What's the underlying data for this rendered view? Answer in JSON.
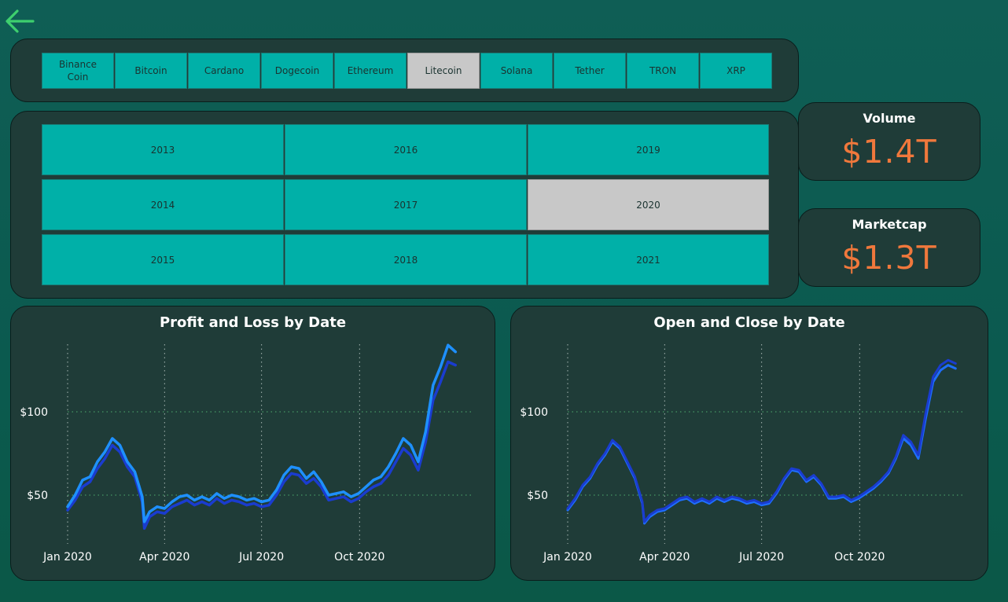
{
  "nav": {
    "back_icon": "arrow-left-icon",
    "back_color": "#3ecf6e"
  },
  "coins": [
    {
      "label": "Binance\nCoin",
      "selected": false
    },
    {
      "label": "Bitcoin",
      "selected": false
    },
    {
      "label": "Cardano",
      "selected": false
    },
    {
      "label": "Dogecoin",
      "selected": false
    },
    {
      "label": "Ethereum",
      "selected": false
    },
    {
      "label": "Litecoin",
      "selected": true
    },
    {
      "label": "Solana",
      "selected": false
    },
    {
      "label": "Tether",
      "selected": false
    },
    {
      "label": "TRON",
      "selected": false
    },
    {
      "label": "XRP",
      "selected": false
    }
  ],
  "years": [
    {
      "label": "2013",
      "selected": false
    },
    {
      "label": "2014",
      "selected": false
    },
    {
      "label": "2015",
      "selected": false
    },
    {
      "label": "2016",
      "selected": false
    },
    {
      "label": "2017",
      "selected": false
    },
    {
      "label": "2018",
      "selected": false
    },
    {
      "label": "2019",
      "selected": false
    },
    {
      "label": "2020",
      "selected": true
    },
    {
      "label": "2021",
      "selected": false
    }
  ],
  "kpis": {
    "volume": {
      "label": "Volume",
      "value": "$1.4T"
    },
    "marketcap": {
      "label": "Marketcap",
      "value": "$1.3T"
    }
  },
  "colors": {
    "tile": "#00b0a8",
    "tile_selected": "#c8c8c8",
    "panel": "#1f3c38",
    "kpi_value": "#f0783c",
    "series_light": "#1e90ff",
    "series_dark": "#1a3ccf"
  },
  "chart_data": [
    {
      "type": "line",
      "title": "Profit and Loss by Date",
      "x": [
        "2020-01-01",
        "2020-01-08",
        "2020-01-15",
        "2020-01-22",
        "2020-01-29",
        "2020-02-05",
        "2020-02-12",
        "2020-02-19",
        "2020-02-26",
        "2020-03-04",
        "2020-03-11",
        "2020-03-13",
        "2020-03-18",
        "2020-03-25",
        "2020-04-01",
        "2020-04-08",
        "2020-04-15",
        "2020-04-22",
        "2020-04-29",
        "2020-05-06",
        "2020-05-13",
        "2020-05-20",
        "2020-05-27",
        "2020-06-03",
        "2020-06-10",
        "2020-06-17",
        "2020-06-24",
        "2020-07-01",
        "2020-07-08",
        "2020-07-15",
        "2020-07-22",
        "2020-07-29",
        "2020-08-05",
        "2020-08-12",
        "2020-08-19",
        "2020-08-26",
        "2020-09-02",
        "2020-09-09",
        "2020-09-16",
        "2020-09-23",
        "2020-09-30",
        "2020-10-07",
        "2020-10-14",
        "2020-10-21",
        "2020-10-28",
        "2020-11-04",
        "2020-11-11",
        "2020-11-18",
        "2020-11-25",
        "2020-12-02",
        "2020-12-09",
        "2020-12-16",
        "2020-12-23",
        "2020-12-30"
      ],
      "series": [
        {
          "values": [
            41,
            47,
            55,
            58,
            66,
            72,
            80,
            76,
            67,
            61,
            46,
            30,
            37,
            40,
            39,
            43,
            45,
            47,
            44,
            46,
            44,
            48,
            45,
            47,
            46,
            44,
            45,
            43,
            44,
            50,
            58,
            63,
            62,
            57,
            60,
            55,
            47,
            48,
            49,
            46,
            48,
            52,
            55,
            57,
            62,
            70,
            78,
            74,
            65,
            82,
            107,
            118,
            130,
            128
          ]
        },
        {
          "values": [
            43,
            50,
            59,
            61,
            70,
            76,
            84,
            80,
            70,
            64,
            49,
            34,
            40,
            43,
            42,
            46,
            49,
            50,
            47,
            49,
            47,
            51,
            48,
            50,
            49,
            47,
            48,
            46,
            47,
            53,
            62,
            67,
            66,
            60,
            64,
            58,
            50,
            51,
            52,
            49,
            51,
            55,
            59,
            61,
            67,
            75,
            84,
            80,
            70,
            88,
            116,
            127,
            140,
            136
          ]
        }
      ],
      "xticks": [
        "Jan 2020",
        "Apr 2020",
        "Jul 2020",
        "Oct 2020"
      ],
      "yticks": [
        "$50",
        "$100"
      ],
      "grid": true
    },
    {
      "type": "line",
      "title": "Open and Close by Date",
      "x": [
        "2020-01-01",
        "2020-01-08",
        "2020-01-15",
        "2020-01-22",
        "2020-01-29",
        "2020-02-05",
        "2020-02-12",
        "2020-02-19",
        "2020-02-26",
        "2020-03-04",
        "2020-03-11",
        "2020-03-13",
        "2020-03-18",
        "2020-03-25",
        "2020-04-01",
        "2020-04-08",
        "2020-04-15",
        "2020-04-22",
        "2020-04-29",
        "2020-05-06",
        "2020-05-13",
        "2020-05-20",
        "2020-05-27",
        "2020-06-03",
        "2020-06-10",
        "2020-06-17",
        "2020-06-24",
        "2020-07-01",
        "2020-07-08",
        "2020-07-15",
        "2020-07-22",
        "2020-07-29",
        "2020-08-05",
        "2020-08-12",
        "2020-08-19",
        "2020-08-26",
        "2020-09-02",
        "2020-09-09",
        "2020-09-16",
        "2020-09-23",
        "2020-09-30",
        "2020-10-07",
        "2020-10-14",
        "2020-10-21",
        "2020-10-28",
        "2020-11-04",
        "2020-11-11",
        "2020-11-18",
        "2020-11-25",
        "2020-12-02",
        "2020-12-09",
        "2020-12-16",
        "2020-12-23",
        "2020-12-30"
      ],
      "series": [
        {
          "values": [
            41,
            47,
            55,
            60,
            68,
            74,
            82,
            78,
            69,
            60,
            45,
            33,
            37,
            40,
            41,
            44,
            47,
            48,
            45,
            47,
            45,
            48,
            46,
            48,
            47,
            45,
            46,
            44,
            45,
            51,
            59,
            65,
            64,
            58,
            61,
            56,
            48,
            48,
            49,
            46,
            48,
            51,
            54,
            58,
            63,
            72,
            84,
            80,
            72,
            96,
            118,
            125,
            128,
            126
          ]
        },
        {
          "values": [
            42,
            48,
            56,
            61,
            69,
            75,
            83,
            79,
            70,
            61,
            46,
            34,
            38,
            41,
            42,
            45,
            48,
            49,
            46,
            48,
            46,
            49,
            47,
            49,
            48,
            46,
            47,
            45,
            46,
            52,
            60,
            66,
            65,
            59,
            62,
            57,
            49,
            49,
            50,
            47,
            49,
            52,
            55,
            59,
            64,
            73,
            86,
            82,
            74,
            99,
            121,
            128,
            131,
            129
          ]
        }
      ],
      "xticks": [
        "Jan 2020",
        "Apr 2020",
        "Jul 2020",
        "Oct 2020"
      ],
      "yticks": [
        "$50",
        "$100"
      ],
      "grid": true
    }
  ]
}
